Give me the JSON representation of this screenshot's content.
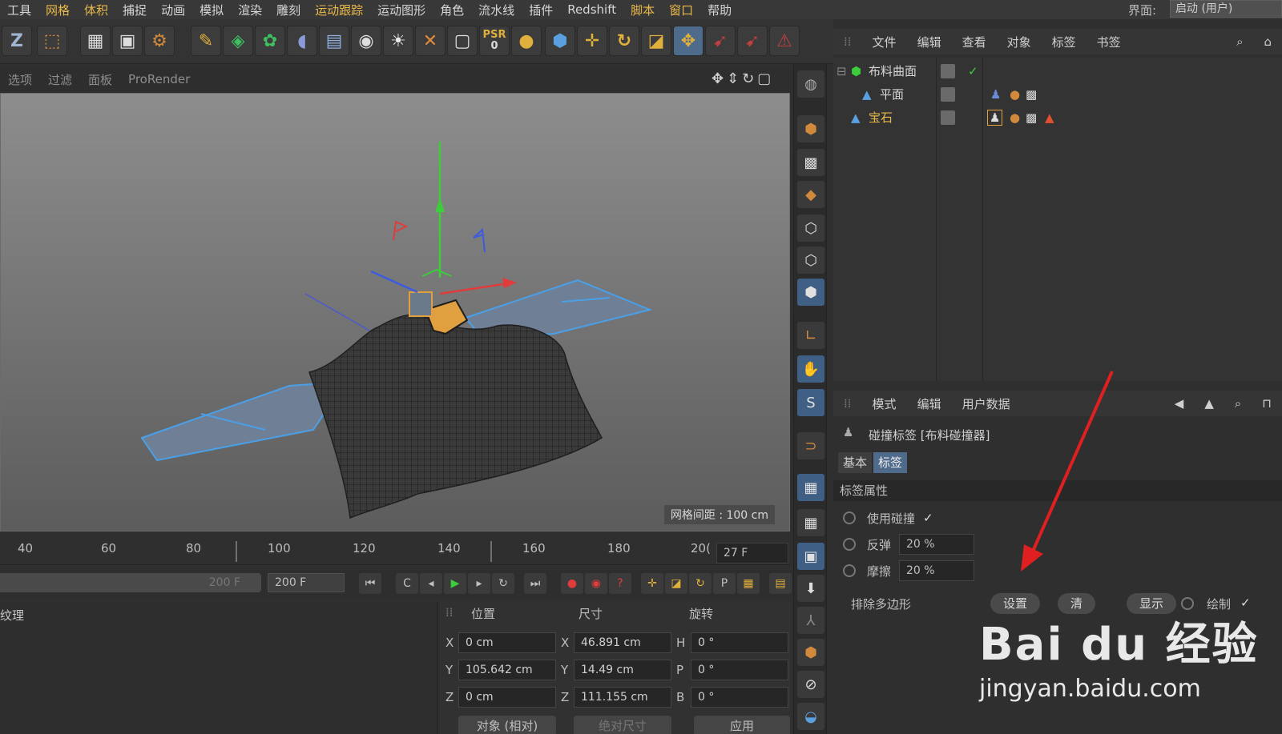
{
  "menu": {
    "items": [
      "工具",
      "网格",
      "体积",
      "捕捉",
      "动画",
      "模拟",
      "渲染",
      "雕刻",
      "运动跟踪",
      "运动图形",
      "角色",
      "流水线",
      "插件",
      "Redshift",
      "脚本",
      "窗口",
      "帮助"
    ],
    "layout_label": "界面:",
    "layout_value": "启动 (用户)"
  },
  "toolbar": {
    "psr_label": "PSR",
    "psr_value": "0"
  },
  "viewport": {
    "menu": [
      "选项",
      "过滤",
      "面板",
      "ProRender"
    ],
    "grid_spacing": "网格间距 : 100 cm"
  },
  "object_manager": {
    "menu": [
      "文件",
      "编辑",
      "查看",
      "对象",
      "标签",
      "书签"
    ],
    "objects": [
      {
        "name": "布料曲面"
      },
      {
        "name": "平面"
      },
      {
        "name": "宝石"
      }
    ]
  },
  "attributes": {
    "menu": [
      "模式",
      "编辑",
      "用户数据"
    ],
    "title": "碰撞标签 [布料碰撞器]",
    "tabs": [
      "基本",
      "标签"
    ],
    "section": "标签属性",
    "use_collision_label": "使用碰撞",
    "bounce_label": "反弹",
    "bounce_value": "20 %",
    "friction_label": "摩擦",
    "friction_value": "20 %",
    "exclude_label": "排除多边形",
    "set_button": "设置",
    "clear_button": "清",
    "show_button": "显示",
    "draw_label": "绘制"
  },
  "timeline": {
    "ticks": [
      "40",
      "60",
      "80",
      "100",
      "120",
      "140",
      "160",
      "180",
      "20("
    ],
    "current_frame": "27 F",
    "slider_value": "200 F",
    "end_frame": "200 F"
  },
  "materials": {
    "title": "纹理"
  },
  "coordinates": {
    "headers": [
      "位置",
      "尺寸",
      "旋转"
    ],
    "pos": {
      "x": "0 cm",
      "y": "105.642 cm",
      "z": "0 cm"
    },
    "size": {
      "x": "46.891 cm",
      "y": "14.49 cm",
      "z": "111.155 cm"
    },
    "rot": {
      "h": "0 °",
      "p": "0 °",
      "b": "0 °"
    },
    "mode_select": "对象 (相对)",
    "size_select": "绝对尺寸",
    "apply_button": "应用"
  },
  "watermark": {
    "logo": "Bai du 经验",
    "url": "jingyan.baidu.com"
  },
  "colors": {
    "accent_blue": "#4f6b8c",
    "highlight_yellow": "#e9b949",
    "annotation_red": "#e02020"
  }
}
